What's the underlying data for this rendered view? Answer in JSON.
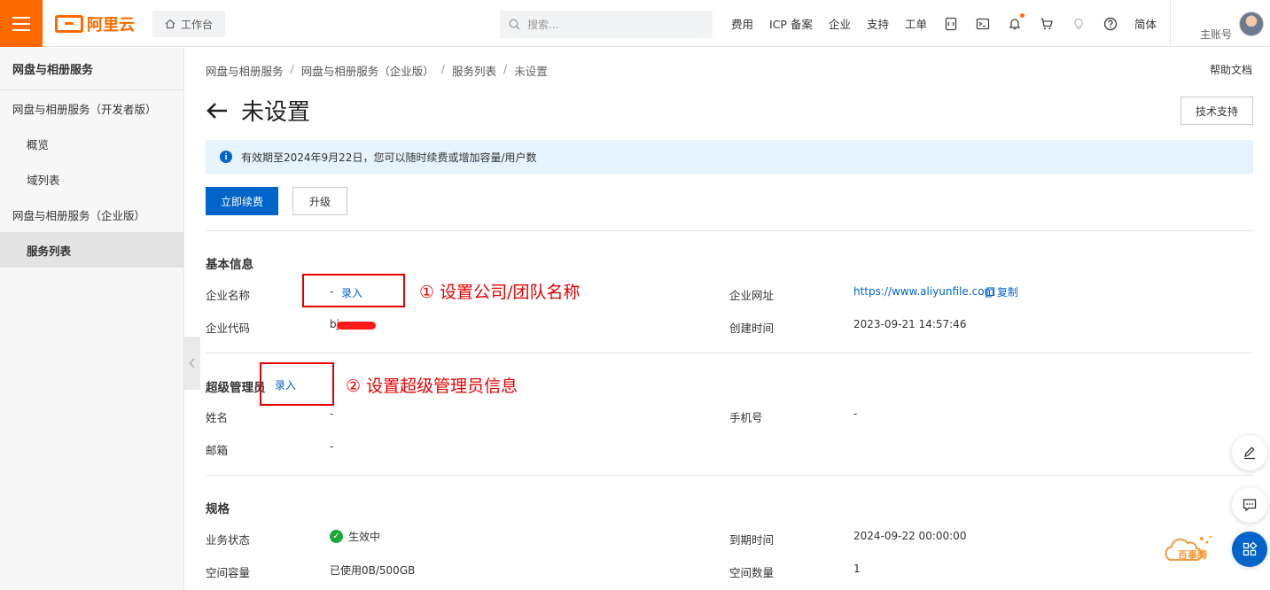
{
  "topbar": {
    "logo_text": "阿里云",
    "workbench_label": "工作台",
    "search_placeholder": "搜索...",
    "nav_items": [
      "费用",
      "ICP 备案",
      "企业",
      "支持",
      "工单"
    ],
    "lang_label": "简体",
    "account_label": "主账号"
  },
  "sidebar": {
    "title": "网盘与相册服务",
    "items": [
      {
        "label": "网盘与相册服务（开发者版）"
      },
      {
        "label": "概览"
      },
      {
        "label": "域列表"
      },
      {
        "label": "网盘与相册服务（企业版）"
      },
      {
        "label": "服务列表"
      }
    ]
  },
  "breadcrumb": [
    "网盘与相册服务",
    "网盘与相册服务（企业版）",
    "服务列表",
    "未设置"
  ],
  "help_doc": "帮助文档",
  "page_title": "未设置",
  "tech_support": "技术支持",
  "notice": "有效期至2024年9月22日，您可以随时续费或增加容量/用户数",
  "buttons": {
    "renew": "立即续费",
    "upgrade": "升级"
  },
  "basic": {
    "title": "基本信息",
    "company_name_label": "企业名称",
    "company_name_value": "-",
    "enter": "录入",
    "company_url_label": "企业网址",
    "company_url_value": "https://www.aliyunfile.com",
    "copy": "复制",
    "company_code_label": "企业代码",
    "company_code_value": "bj",
    "created_label": "创建时间",
    "created_value": "2023-09-21 14:57:46"
  },
  "admin": {
    "title": "超级管理员",
    "enter": "录入",
    "name_label": "姓名",
    "name_value": "-",
    "phone_label": "手机号",
    "phone_value": "-",
    "email_label": "邮箱",
    "email_value": "-"
  },
  "spec": {
    "title": "规格",
    "status_label": "业务状态",
    "status_value": "生效中",
    "expire_label": "到期时间",
    "expire_value": "2024-09-22 00:00:00",
    "capacity_label": "空间容量",
    "capacity_value": "已使用0B/500GB",
    "count_label": "空间数量",
    "count_value": "1"
  },
  "annotations": {
    "a1": "① 设置公司/团队名称",
    "a2": "② 设置超级管理员信息"
  },
  "watermark": "百事腾",
  "colors": {
    "brand": "#ff6a00",
    "primary": "#0064c8",
    "annotation": "#e60000"
  }
}
